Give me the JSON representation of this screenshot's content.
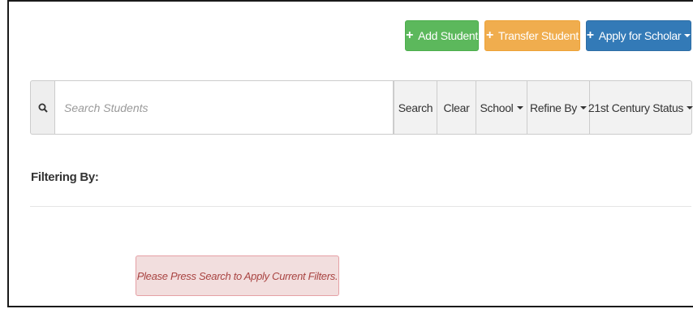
{
  "actions": {
    "add_student": "Add Student",
    "transfer_student": "Transfer Student",
    "apply_scholar": "Apply for Scholar"
  },
  "search": {
    "placeholder": "Search Students",
    "search_label": "Search",
    "clear_label": "Clear",
    "school_label": "School",
    "refine_label": "Refine By",
    "status_label": "21st Century Status"
  },
  "filters": {
    "heading": "Filtering By:"
  },
  "alert": {
    "message": "Please Press Search to Apply Current Filters."
  },
  "colors": {
    "success": "#5cb85c",
    "warning": "#f0ad4e",
    "primary": "#337ab7",
    "danger_bg": "#f2dede",
    "danger_text": "#a94442"
  },
  "icons": {
    "search": "magnifier-icon",
    "plus": "plus-icon",
    "caret": "caret-down-icon"
  }
}
